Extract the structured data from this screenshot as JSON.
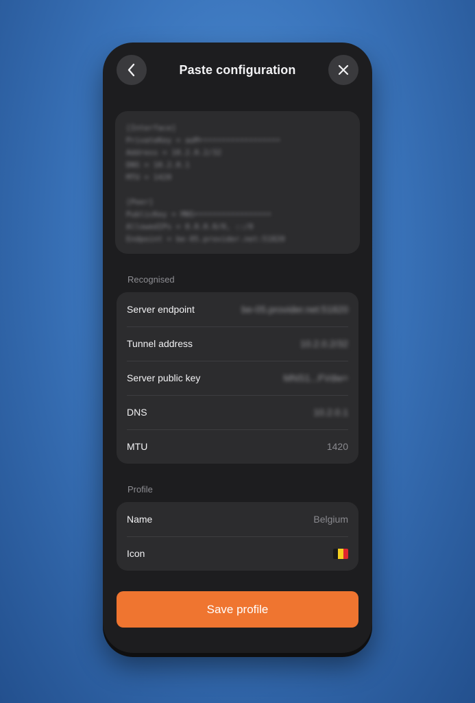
{
  "header": {
    "title": "Paste configuration",
    "back_icon": "chevron-left-icon",
    "close_icon": "close-icon"
  },
  "config": {
    "text": "[Interface]\nPrivateKey = aoM••••••••••••••••••\nAddress = 10.2.0.2/32\nDNS = 10.2.0.1\nMTU = 1420\n\n[Peer]\nPublicKey = MNS•••••••••••••••••\nAllowedIPs = 0.0.0.0/0, ::/0\nEndpoint = be-05.provider.net:51820"
  },
  "recognised": {
    "label": "Recognised",
    "rows": [
      {
        "label": "Server endpoint",
        "value": "be-05.provider.net:51820",
        "blurred": true
      },
      {
        "label": "Tunnel address",
        "value": "10.2.0.2/32",
        "blurred": true
      },
      {
        "label": "Server public key",
        "value": "MNS1...FVdw=",
        "blurred": true
      },
      {
        "label": "DNS",
        "value": "10.2.0.1",
        "blurred": true
      },
      {
        "label": "MTU",
        "value": "1420",
        "blurred": false
      }
    ]
  },
  "profile": {
    "label": "Profile",
    "name_label": "Name",
    "name_value": "Belgium",
    "icon_label": "Icon",
    "icon_flag": "belgium-flag-icon",
    "flag_colors": [
      "#1a1a1a",
      "#f5d020",
      "#e0262d"
    ]
  },
  "actions": {
    "save_label": "Save profile"
  },
  "colors": {
    "accent": "#ef7530",
    "surface": "#2c2c2e",
    "background": "#1d1d1f"
  }
}
